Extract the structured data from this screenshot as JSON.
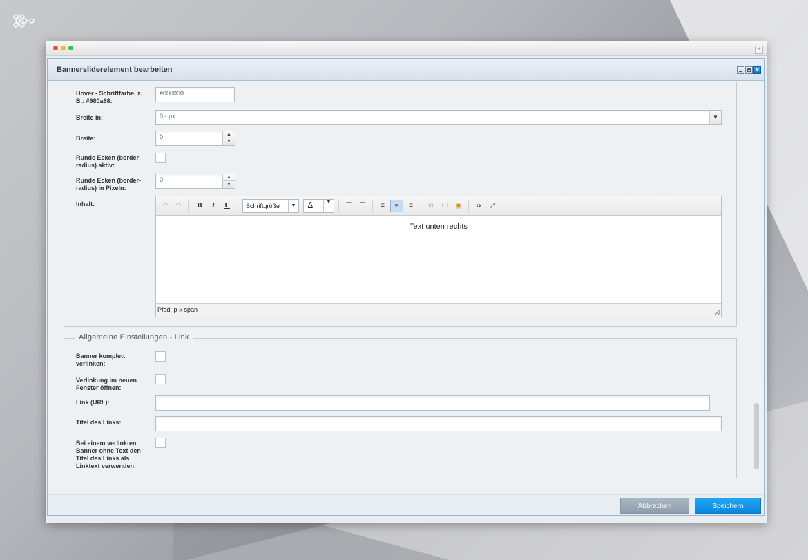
{
  "dialog": {
    "title": "Bannersliderelement bearbeiten"
  },
  "form": {
    "hover_color": {
      "label": "Hover - Schriftfarbe, z. B.: #980a88:",
      "value": "#000000"
    },
    "width_unit": {
      "label": "Breite in:",
      "value": "0 - px"
    },
    "width": {
      "label": "Breite:",
      "value": "0"
    },
    "rounded": {
      "label": "Runde Ecken (border-radius) aktiv:"
    },
    "radius": {
      "label": "Runde Ecken (border-radius) in Pixeln:",
      "value": "0"
    },
    "content": {
      "label": "Inhalt:"
    }
  },
  "editor": {
    "font_size_label": "Schriftgröße",
    "color_letter": "A",
    "content_text": "Text unten rechts",
    "path": "Pfad: p » span",
    "icons": [
      "undo-icon",
      "redo-icon",
      "bold-icon",
      "italic-icon",
      "underline-icon",
      "font-size-select",
      "text-color-select",
      "bullet-list-icon",
      "numbered-list-icon",
      "align-left-icon",
      "align-center-icon",
      "align-right-icon",
      "link-icon",
      "unlink-icon",
      "image-icon",
      "source-code-icon",
      "fullscreen-icon"
    ],
    "bold_letter": "B",
    "italic_letter": "I",
    "underline_letter": "U"
  },
  "link_section": {
    "legend": "Allgemeine Einstellungen - Link",
    "banner_link": {
      "label": "Banner komplett verlinken:"
    },
    "new_window": {
      "label": "Verlinkung im neuen Fenster öffnen:"
    },
    "url": {
      "label": "Link (URL):",
      "value": ""
    },
    "title": {
      "label": "Titel des Links:",
      "value": ""
    },
    "title_as_text": {
      "label": "Bei einem verlinkten Banner ohne Text den Titel des Links als Linktext verwenden:"
    }
  },
  "footer": {
    "cancel": "Abbrechen",
    "save": "Speichern"
  },
  "colors": {
    "accent": "#0a86de",
    "cancel": "#9aa8b6",
    "header": "#d8e2ec"
  }
}
